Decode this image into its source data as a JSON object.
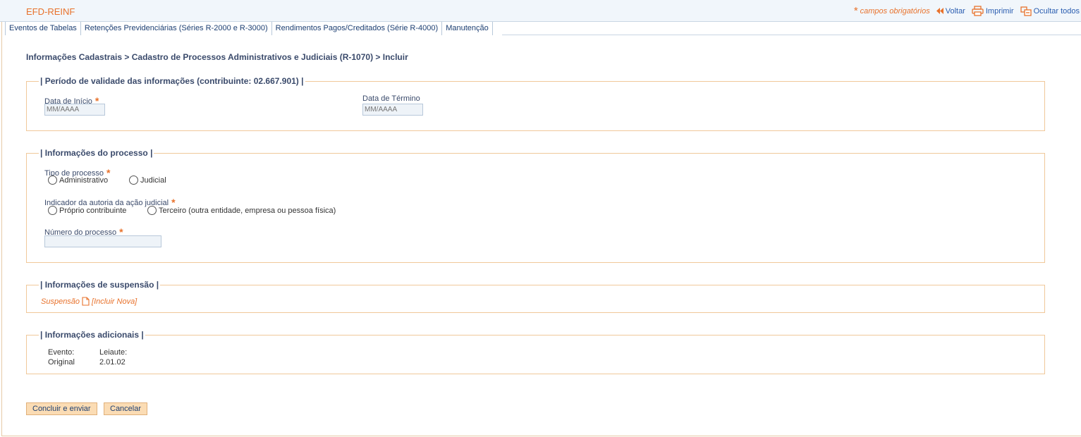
{
  "app": {
    "title": "EFD-REINF"
  },
  "toolbar": {
    "required_note": "campos obrigatórios",
    "back": "Voltar",
    "print": "Imprimir",
    "hide_all": "Ocultar todos"
  },
  "tabs": [
    {
      "label": "Eventos de Tabelas"
    },
    {
      "label": "Retenções Previdenciárias (Séries R-2000 e R-3000)"
    },
    {
      "label": "Rendimentos Pagos/Creditados (Série R-4000)"
    },
    {
      "label": "Manutenção"
    }
  ],
  "breadcrumb": "Informações Cadastrais > Cadastro de Processos Administrativos e Judiciais (R-1070) > Incluir",
  "validity": {
    "legend": "| Período de validade das informações (contribuinte: 02.667.901) |",
    "start_label": "Data de Início",
    "start_placeholder": "MM/AAAA",
    "end_label": "Data de Término",
    "end_placeholder": "MM/AAAA"
  },
  "process": {
    "legend": "| Informações do processo |",
    "type_label": "Tipo de processo",
    "type_options": [
      "Administrativo",
      "Judicial"
    ],
    "authorship_label": "Indicador da autoria da ação judicial",
    "authorship_options": [
      "Próprio contribuinte",
      "Terceiro (outra entidade, empresa ou pessoa física)"
    ],
    "number_label": "Número do processo",
    "number_value": ""
  },
  "suspension": {
    "legend": "| Informações de suspensão |",
    "item_label": "Suspensão",
    "add_link": "[Incluir Nova]"
  },
  "additional": {
    "legend": "| Informações adicionais |",
    "event_label": "Evento:",
    "event_value": "Original",
    "layout_label": "Leiaute:",
    "layout_value": "2.01.02"
  },
  "buttons": {
    "submit": "Concluir e enviar",
    "cancel": "Cancelar"
  },
  "colors": {
    "accent_orange": "#e8722c",
    "link_blue": "#2a5db0",
    "border_orange": "#f0c89a",
    "button_bg": "#fbdcb4"
  }
}
